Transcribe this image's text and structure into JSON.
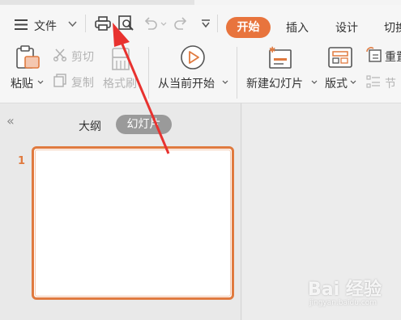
{
  "menubar": {
    "file_label": "文件",
    "tabs": [
      {
        "label": "开始",
        "active": true
      },
      {
        "label": "插入"
      },
      {
        "label": "设计"
      },
      {
        "label": "切换"
      }
    ]
  },
  "ribbon": {
    "paste": "粘贴",
    "cut": "剪切",
    "copy": "复制",
    "format_painter": "格式刷",
    "from_current": "从当前开始",
    "new_slide": "新建幻灯片",
    "layout": "版式",
    "reset": "重置",
    "section": "节"
  },
  "panel": {
    "outline_tab": "大纲",
    "slides_tab": "幻灯片",
    "slide_number": "1",
    "collapse_glyph": "«"
  },
  "colors": {
    "accent": "#e8743d",
    "annotation_arrow": "#e8322f"
  },
  "watermark": {
    "brand": "Bai 经验",
    "url": "jingyan.baidu.com"
  }
}
